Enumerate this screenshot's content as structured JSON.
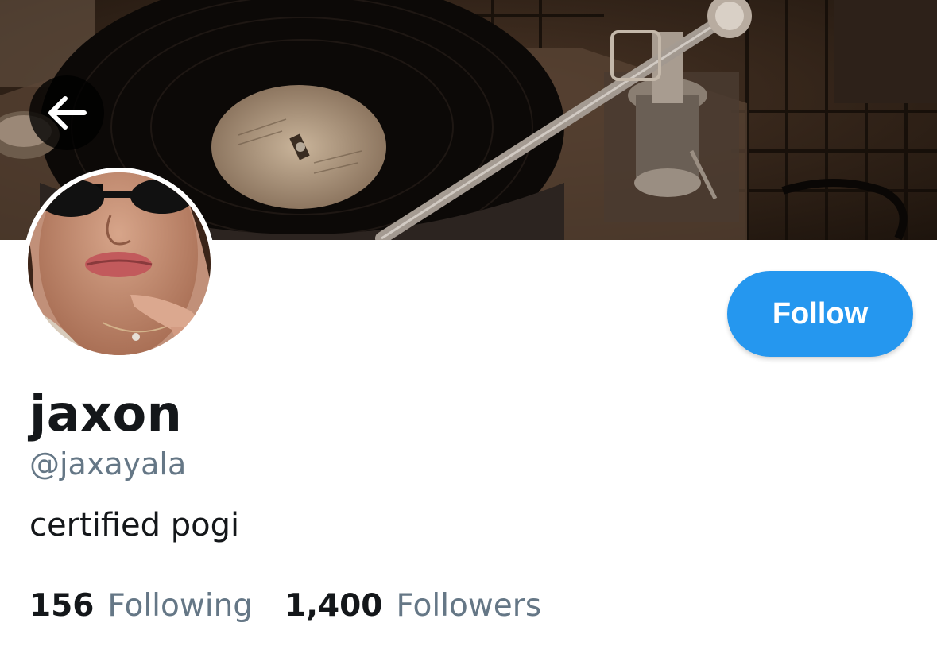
{
  "profile": {
    "display_name": "jaxon",
    "handle": "@jaxayala",
    "bio": "certified pogi",
    "following_count": "156",
    "following_label": "Following",
    "followers_count": "1,400",
    "followers_label": "Followers"
  },
  "actions": {
    "follow_label": "Follow",
    "back_icon": "arrow-left-icon"
  },
  "colors": {
    "accent": "#2597ef",
    "primary_text": "#14171a",
    "secondary_text": "#657786"
  }
}
